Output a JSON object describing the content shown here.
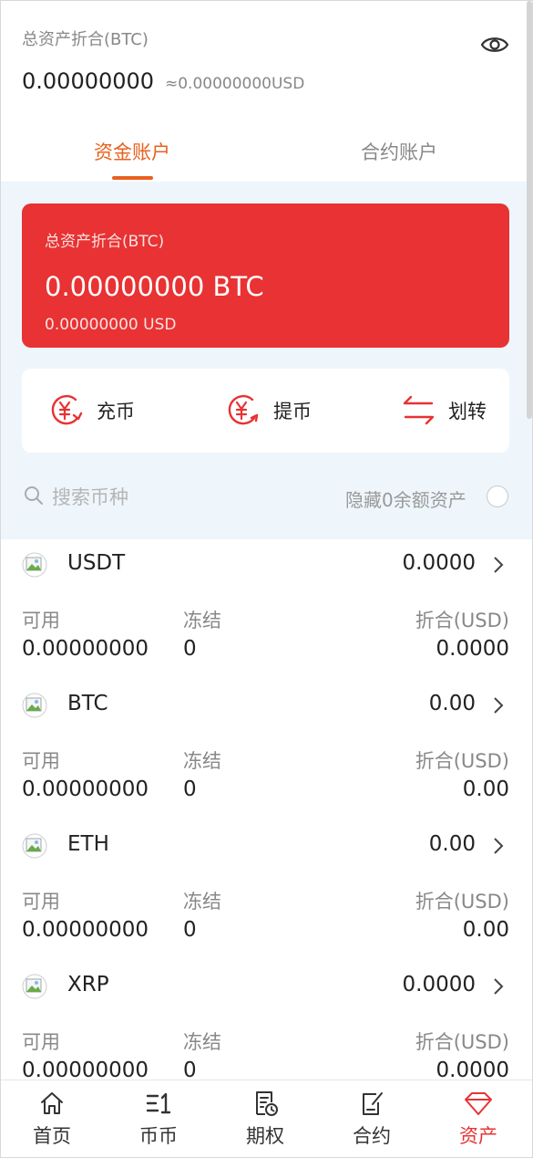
{
  "header": {
    "total_label": "总资产折合(BTC)",
    "total_value": "0.00000000",
    "total_usd": "≈0.00000000USD",
    "eye_icon": "eye-icon"
  },
  "tabs": [
    {
      "label": "资金账户",
      "active": true
    },
    {
      "label": "合约账户",
      "active": false
    }
  ],
  "summary_card": {
    "label": "总资产折合(BTC)",
    "value": "0.00000000 BTC",
    "usd": "0.00000000 USD",
    "color": "#e83233"
  },
  "actions": [
    {
      "label": "充币",
      "icon": "deposit-icon"
    },
    {
      "label": "提币",
      "icon": "withdraw-icon"
    },
    {
      "label": "划转",
      "icon": "transfer-icon"
    }
  ],
  "search": {
    "placeholder": "搜索币种",
    "hide_zero_label": "隐藏0余额资产",
    "hide_zero_checked": false
  },
  "columns": {
    "available": "可用",
    "frozen": "冻结",
    "converted": "折合(USD)"
  },
  "coins": [
    {
      "name": "USDT",
      "total": "0.0000",
      "available": "0.00000000",
      "frozen": "0",
      "converted": "0.0000"
    },
    {
      "name": "BTC",
      "total": "0.00",
      "available": "0.00000000",
      "frozen": "0",
      "converted": "0.00"
    },
    {
      "name": "ETH",
      "total": "0.00",
      "available": "0.00000000",
      "frozen": "0",
      "converted": "0.00"
    },
    {
      "name": "XRP",
      "total": "0.0000",
      "available": "0.00000000",
      "frozen": "0",
      "converted": "0.0000"
    }
  ],
  "nav": [
    {
      "label": "首页",
      "icon": "home-icon",
      "active": false
    },
    {
      "label": "币币",
      "icon": "coin-trade-icon",
      "active": false
    },
    {
      "label": "期权",
      "icon": "option-icon",
      "active": false
    },
    {
      "label": "合约",
      "icon": "contract-icon",
      "active": false
    },
    {
      "label": "资产",
      "icon": "diamond-icon",
      "active": true
    }
  ],
  "colors": {
    "accent": "#e8611f",
    "brand_red": "#e83233",
    "page_tint": "#eef6fc"
  }
}
